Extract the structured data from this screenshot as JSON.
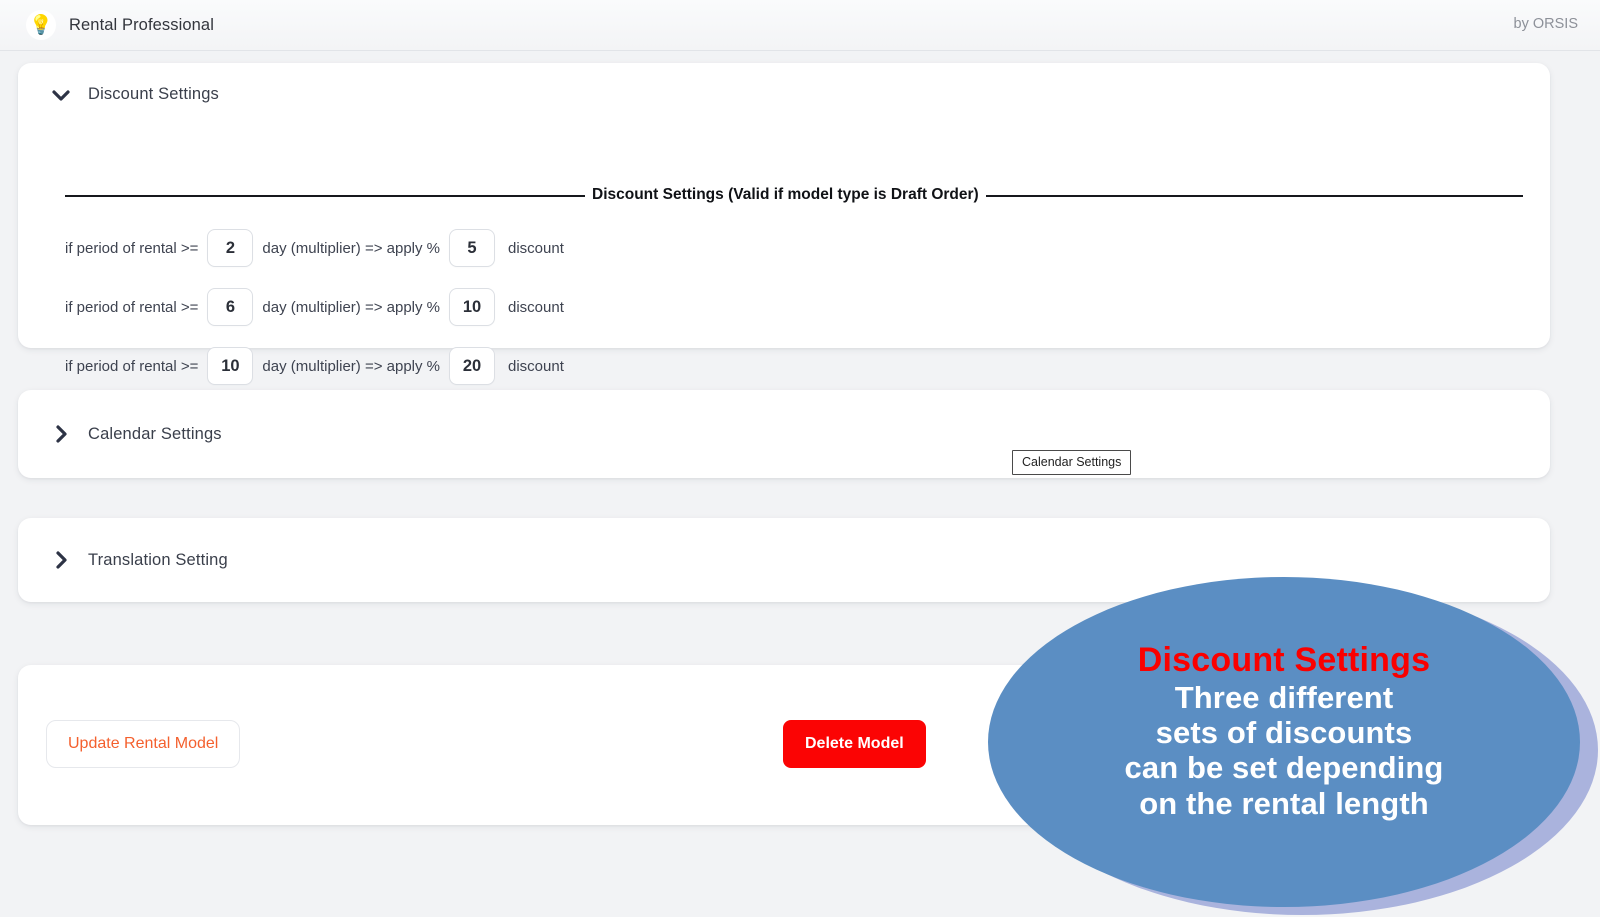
{
  "header": {
    "logo_icon": "lightbulb-icon",
    "app_title": "Rental Professional",
    "byline": "by ORSIS"
  },
  "sections": {
    "discount": {
      "title": "Discount Settings",
      "chevron_icon": "chevron-down-icon",
      "expanded": true,
      "legend": "Discount Settings (Valid if model type is Draft Order)",
      "rows": [
        {
          "prefix": "if period of rental >=",
          "days": "2",
          "middle": "day (multiplier) => apply %",
          "percent": "5",
          "suffix": "discount"
        },
        {
          "prefix": "if period of rental >=",
          "days": "6",
          "middle": "day (multiplier) => apply %",
          "percent": "10",
          "suffix": "discount"
        },
        {
          "prefix": "if period of rental >=",
          "days": "10",
          "middle": "day (multiplier) => apply %",
          "percent": "20",
          "suffix": "discount"
        }
      ]
    },
    "calendar": {
      "title": "Calendar Settings",
      "chevron_icon": "chevron-right-icon",
      "expanded": false,
      "tooltip": "Calendar Settings"
    },
    "translation": {
      "title": "Translation Setting",
      "chevron_icon": "chevron-right-icon",
      "expanded": false
    }
  },
  "actions": {
    "update_label": "Update Rental Model",
    "delete_label": "Delete Model",
    "update_color": "#f4602e",
    "delete_color": "#fb0404"
  },
  "annotation": {
    "title": "Discount Settings",
    "line1": "Three different",
    "line2": "sets of discounts",
    "line3": "can be set depending",
    "line4": "on the rental length",
    "title_color": "#fa0000",
    "body_color": "#ffffff",
    "bubble_color": "#5b8ec3",
    "halo_color": "#aab3dd"
  }
}
